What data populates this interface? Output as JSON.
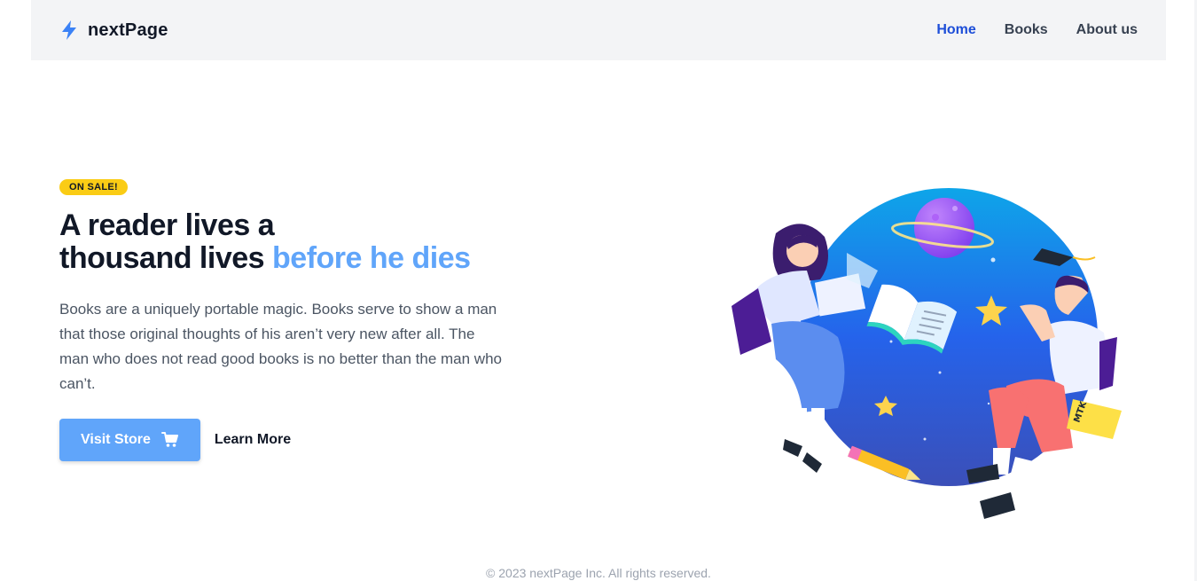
{
  "brand": {
    "name": "nextPage",
    "icon": "lightning-bolt-icon",
    "accent": "#3b82f6"
  },
  "nav": {
    "links": [
      {
        "label": "Home",
        "active": true
      },
      {
        "label": "Books",
        "active": false
      },
      {
        "label": "About us",
        "active": false
      }
    ]
  },
  "hero": {
    "badge": "ON SALE!",
    "headline_line1": "A reader lives a",
    "headline_line2": "thousand lives",
    "headline_accent": "before he dies",
    "description": "Books are a uniquely portable magic. Books serve to show a man that those original thoughts of his aren’t very new after all. The man who does not read good books is no better than the man who can’t.",
    "primary_button": {
      "label": "Visit Store",
      "icon": "shopping-cart-icon"
    },
    "secondary_button": {
      "label": "Learn More"
    },
    "illustration_label": "MTK"
  },
  "footer": {
    "text": "© 2023 nextPage Inc. All rights reserved."
  },
  "colors": {
    "accent": "#60a5fa",
    "nav_active": "#1d4ed8",
    "badge": "#facc15",
    "navbar_bg": "#f3f4f6"
  }
}
